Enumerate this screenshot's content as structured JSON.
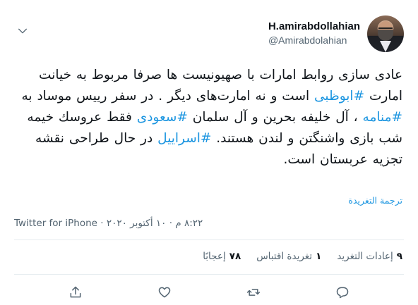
{
  "header": {
    "display_name": "H.amirabdollahian",
    "handle": "@Amirabdolahian"
  },
  "tweet": {
    "segments": [
      {
        "text": "عادی سازی روابط امارات با صهیونیست ها صرفا مربوط به خیانت امارت ",
        "hashtag": false
      },
      {
        "text": "#ابوظبی",
        "hashtag": true
      },
      {
        "text": " است و نه امارت‌های دیگر . در سفر رییس موساد به ",
        "hashtag": false
      },
      {
        "text": "#منامه",
        "hashtag": true
      },
      {
        "text": " ، آل خلیفه بحرین و آل سلمان ",
        "hashtag": false
      },
      {
        "text": "#سعودی",
        "hashtag": true
      },
      {
        "text": " فقط عروسك خیمه شب بازی واشنگتن و لندن هستند. ",
        "hashtag": false
      },
      {
        "text": "#اسراییل",
        "hashtag": true
      },
      {
        "text": " در حال طراحی نقشه تجزیه عربستان است.",
        "hashtag": false
      }
    ],
    "translate_label": "ترجمة التغريدة",
    "time": "٨:٢٢ م",
    "date": "١٠ أكتوبر ٢٠٢٠",
    "separator": "·",
    "source": "Twitter for iPhone"
  },
  "stats": {
    "retweets_count": "٩",
    "retweets_label": "إعادات التغريد",
    "quotes_count": "١",
    "quotes_label": "تغريدة اقتباس",
    "likes_count": "٧٨",
    "likes_label": "إعجابًا"
  },
  "icons": {
    "caret": "chevron-down-icon",
    "reply": "reply-icon",
    "retweet": "retweet-icon",
    "like": "heart-icon",
    "share": "share-icon"
  },
  "colors": {
    "hashtag": "#1b95e0",
    "muted": "#536471",
    "text": "#0f1419"
  }
}
